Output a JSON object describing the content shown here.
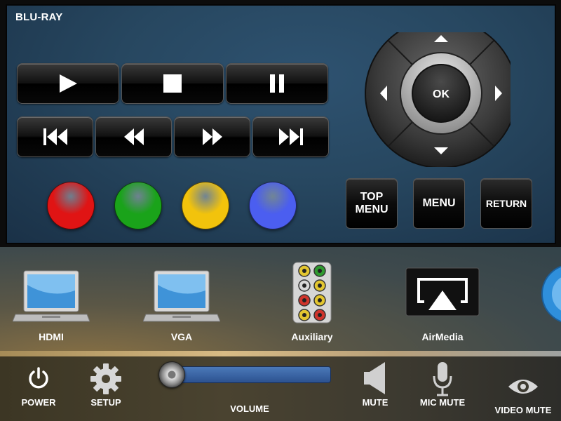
{
  "panel": {
    "title": "BLU-RAY"
  },
  "transport": {
    "row1": [
      {
        "icon": "play-icon"
      },
      {
        "icon": "stop-icon"
      },
      {
        "icon": "pause-icon"
      }
    ],
    "row2": [
      {
        "icon": "skip-previous-icon"
      },
      {
        "icon": "rewind-icon"
      },
      {
        "icon": "fast-forward-icon"
      },
      {
        "icon": "skip-next-icon"
      }
    ]
  },
  "color_buttons": [
    {
      "name": "red",
      "color": "#e01414"
    },
    {
      "name": "green",
      "color": "#1aa31a"
    },
    {
      "name": "yellow",
      "color": "#f2c30c"
    },
    {
      "name": "blue",
      "color": "#4b5ef0"
    }
  ],
  "menu_buttons": {
    "top_menu": "TOP\nMENU",
    "menu": "MENU",
    "return": "RETURN"
  },
  "dpad": {
    "ok_label": "OK"
  },
  "sources": [
    {
      "label": "HDMI",
      "icon": "laptop-icon"
    },
    {
      "label": "VGA",
      "icon": "laptop-icon"
    },
    {
      "label": "Auxiliary",
      "icon": "av-connectors-icon"
    },
    {
      "label": "AirMedia",
      "icon": "airplay-icon"
    }
  ],
  "bottom": {
    "power": "POWER",
    "setup": "SETUP",
    "volume": "VOLUME",
    "mute": "MUTE",
    "mic_mute": "MIC MUTE",
    "video_mute": "VIDEO MUTE"
  },
  "volume_level": 0.0
}
